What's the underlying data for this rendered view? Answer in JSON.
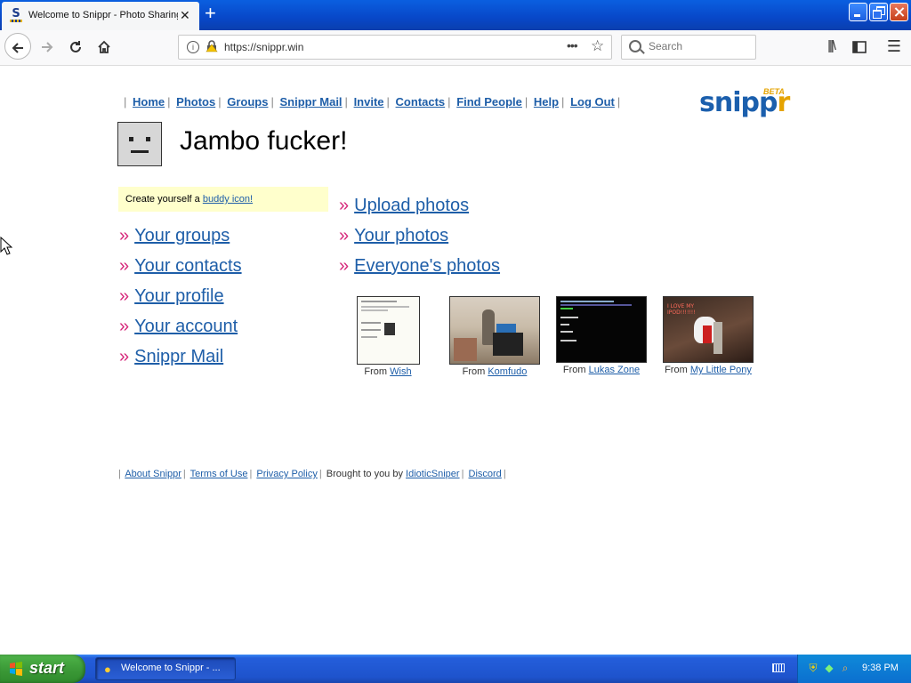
{
  "window": {
    "tab_title": "Welcome to Snippr - Photo Sharing",
    "tab_favicon_letter": "S"
  },
  "toolbar": {
    "url": "https://snippr.win",
    "search_placeholder": "Search"
  },
  "site": {
    "logo_text": "snipp",
    "logo_text_end": "r",
    "logo_badge": "BETA",
    "nav": [
      "Home",
      "Photos",
      "Groups",
      "Snippr Mail",
      "Invite",
      "Contacts",
      "Find People",
      "Help",
      "Log Out"
    ],
    "greeting": "Jambo fucker!",
    "buddy_prompt": "Create yourself a ",
    "buddy_link": "buddy icon!",
    "bullet": "»",
    "left_links": [
      "Your groups",
      "Your contacts",
      "Your profile",
      "Your account",
      "Snippr Mail"
    ],
    "right_links": [
      "Upload photos",
      "Your photos",
      "Everyone's photos"
    ],
    "from_label": "From",
    "thumbnails": [
      {
        "owner": "Wish",
        "style": "screenshot-light"
      },
      {
        "owner": "Komfudo",
        "style": "room-photo"
      },
      {
        "owner": "Lukas Zone",
        "style": "terminal-dark"
      },
      {
        "owner": "My Little Pony",
        "style": "pony-photo",
        "overlay_text": "I LOVE MY IPOD!!!!!!!"
      }
    ],
    "footer_links": [
      "About Snippr",
      "Terms of Use",
      "Privacy Policy"
    ],
    "footer_credit": "Brought to you by",
    "footer_author": "IdioticSniper",
    "footer_discord": "Discord"
  },
  "taskbar": {
    "start_label": "start",
    "task_label": "Welcome to Snippr - ...",
    "clock": "9:38 PM"
  },
  "colors": {
    "link": "#1e5ea8",
    "bullet": "#d6267a",
    "logo_blue": "#1b5fad",
    "logo_orange": "#e5a300",
    "buddy_box": "#ffffcc"
  }
}
